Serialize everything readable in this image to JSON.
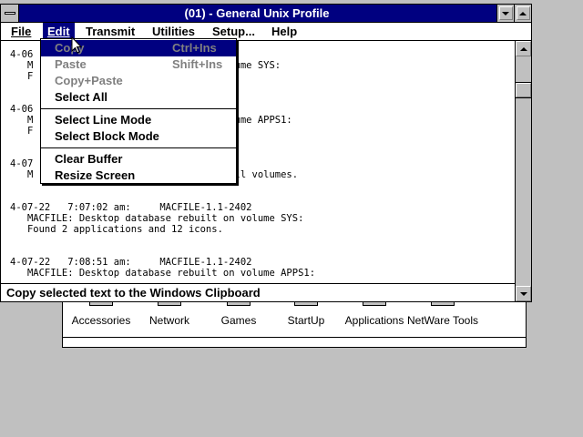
{
  "background_group": {
    "icons": [
      "Accessories",
      "Network",
      "Games",
      "StartUp",
      "Applications",
      "NetWare Tools"
    ]
  },
  "window": {
    "title": "(01) - General Unix Profile"
  },
  "menubar": {
    "file": "File",
    "edit": "Edit",
    "transmit": "Transmit",
    "utilities": "Utilities",
    "setup": "Setup...",
    "help": "Help"
  },
  "edit_menu": {
    "copy": {
      "label": "Copy",
      "accel": "Ctrl+Ins"
    },
    "paste": {
      "label": "Paste",
      "accel": "Shift+Ins"
    },
    "copy_paste": {
      "label": "Copy+Paste"
    },
    "select_all": {
      "label": "Select All"
    },
    "select_line": {
      "label": "Select Line Mode"
    },
    "select_block": {
      "label": "Select Block Mode"
    },
    "clear_buffer": {
      "label": "Clear Buffer"
    },
    "resize_screen": {
      "label": "Resize Screen"
    }
  },
  "terminal": {
    "lines": [
      "4-06                          -2402",
      "   M                          lt on volume SYS:",
      "   F                          ns.",
      "",
      "",
      "4-06                          -2402",
      "   M                          lt on volume APPS1:",
      "   F                          s.",
      "",
      "",
      "4-07                          -2330",
      "   M                          sted on all volumes.",
      "",
      "",
      "4-07-22   7:07:02 am:     MACFILE-1.1-2402",
      "   MACFILE: Desktop database rebuilt on volume SYS:",
      "   Found 2 applications and 12 icons.",
      "",
      "",
      "4-07-22   7:08:51 am:     MACFILE-1.1-2402",
      "   MACFILE: Desktop database rebuilt on volume APPS1:"
    ]
  },
  "status_bar": {
    "text": "Copy selected text to the Windows Clipboard"
  }
}
